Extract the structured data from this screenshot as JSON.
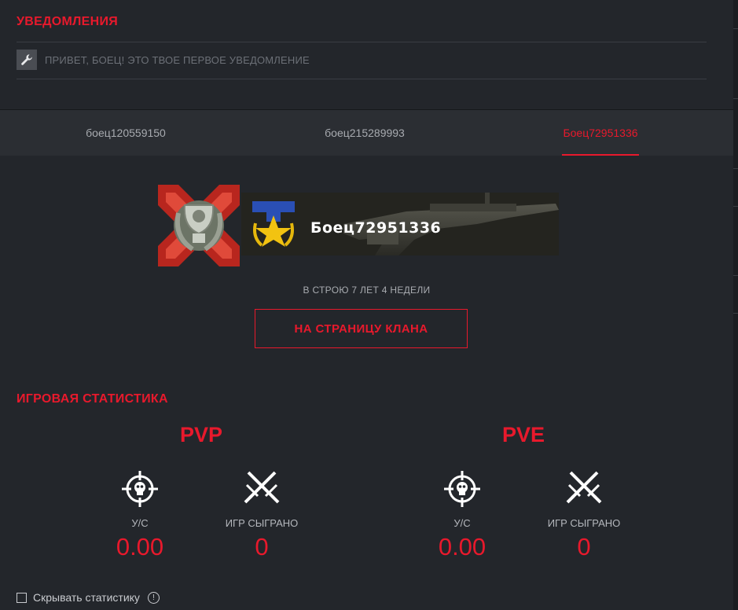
{
  "notifications": {
    "title": "УВЕДОМЛЕНИЯ",
    "items": [
      {
        "icon": "wrench-icon",
        "text": "ПРИВЕТ, БОЕЦ! ЭТО ТВОЕ ПЕРВОЕ УВЕДОМЛЕНИЕ"
      }
    ]
  },
  "tabs": [
    {
      "label": "боец120559150",
      "active": false
    },
    {
      "label": "боец215289993",
      "active": false
    },
    {
      "label": "Боец72951336",
      "active": true
    }
  ],
  "profile": {
    "name": "Боец72951336",
    "service_time": "В СТРОЮ 7 ЛЕТ 4 НЕДЕЛИ",
    "clan_button": "НА СТРАНИЦУ КЛАНА",
    "rank_icon": "rank-badge-icon",
    "achievement_icon": "trophy-badge-icon",
    "weapon_image": "rifle-banner"
  },
  "stats": {
    "title": "ИГРОВАЯ СТАТИСТИКА",
    "modes": [
      {
        "name": "PVP",
        "kd_label": "У/С",
        "kd_value": "0.00",
        "games_label": "ИГР СЫГРАНО",
        "games_value": "0"
      },
      {
        "name": "PVE",
        "kd_label": "У/С",
        "kd_value": "0.00",
        "games_label": "ИГР СЫГРАНО",
        "games_value": "0"
      }
    ],
    "hide_label": "Скрывать статистику"
  },
  "colors": {
    "accent": "#e8192c",
    "background": "#23262b",
    "tab_bar": "#2b2e33"
  }
}
